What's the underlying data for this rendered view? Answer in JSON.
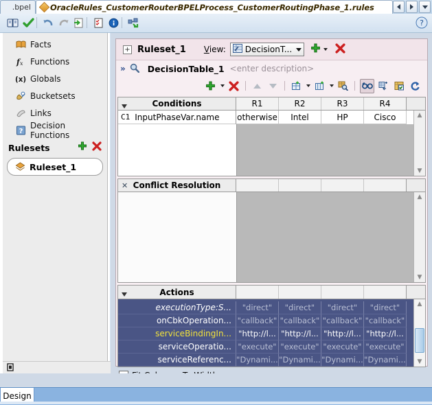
{
  "tabs": {
    "inactive_label": ".bpel",
    "active_label": "OracleRules_CustomerRouterBPELProcess_CustomerRoutingPhase_1.rules",
    "nav_prev": "◀",
    "nav_next": "▶",
    "nav_list": "▼"
  },
  "main_toolbar": {
    "items": [
      {
        "name": "dictionary-icon",
        "glyph": "📖"
      },
      {
        "name": "validate-check-icon",
        "glyph": "✔"
      },
      {
        "name": "undo-icon",
        "glyph": "↺"
      },
      {
        "name": "redo-icon",
        "glyph": "↻"
      },
      {
        "name": "export-icon",
        "glyph": "⇥"
      },
      {
        "name": "test-checklist-icon",
        "glyph": "☑"
      },
      {
        "name": "info-icon",
        "glyph": "i"
      },
      {
        "name": "link-dictionary-icon",
        "glyph": "⊞"
      }
    ],
    "help_label": "?"
  },
  "sidebar": {
    "items": [
      {
        "label": "Facts",
        "icon": "facts-icon",
        "glyph": "📙"
      },
      {
        "label": "Functions",
        "icon": "functions-icon",
        "glyph": "fx"
      },
      {
        "label": "Globals",
        "icon": "globals-icon",
        "glyph": "(x)"
      },
      {
        "label": "Bucketsets",
        "icon": "bucketsets-icon",
        "glyph": "🎨"
      },
      {
        "label": "Links",
        "icon": "links-icon",
        "glyph": "🔗"
      },
      {
        "label": "Decision Functions",
        "icon": "decision-functions-icon",
        "glyph": "?"
      }
    ],
    "section_title": "Rulesets",
    "add_label": "+",
    "delete_label": "✖",
    "ruleset_item": "Ruleset_1",
    "status_icon": "edit-marker-icon"
  },
  "ruleset": {
    "expander": "+",
    "name": "Ruleset_1",
    "view_label": "View:",
    "view_value": "DecisionT...",
    "view_icon": "decision-table-icon",
    "add_label": "+",
    "delete_label": "✖"
  },
  "decision_table": {
    "chevron": "»",
    "search_icon": "magnifier-icon",
    "name": "DecisionTable_1",
    "description_placeholder": "<enter description>",
    "toolbar": [
      {
        "name": "add-button",
        "glyph": "+",
        "has_dropdown": true
      },
      {
        "name": "delete-button",
        "glyph": "✖",
        "has_dropdown": false
      },
      {
        "name": "move-up-button",
        "glyph": "▲",
        "has_dropdown": false
      },
      {
        "name": "move-down-button",
        "glyph": "▼",
        "has_dropdown": false
      },
      {
        "name": "split-table-button",
        "glyph": "▦",
        "has_dropdown": true
      },
      {
        "name": "merge-table-button",
        "glyph": "▤",
        "has_dropdown": true
      },
      {
        "name": "find-rules-button",
        "glyph": "🔍",
        "has_dropdown": false
      },
      {
        "name": "gap-analysis-button",
        "glyph": "👓",
        "has_dropdown": false,
        "pressed": true
      },
      {
        "name": "compact-rules-button",
        "glyph": "⧉",
        "has_dropdown": false
      },
      {
        "name": "split-cells-button",
        "glyph": "▩",
        "has_dropdown": false
      },
      {
        "name": "refresh-button",
        "glyph": "↻",
        "has_dropdown": false
      }
    ]
  },
  "conditions": {
    "title": "Conditions",
    "rule_columns": [
      "R1",
      "R2",
      "R3",
      "R4"
    ],
    "rows": [
      {
        "id": "C1",
        "expression": "InputPhaseVar.name",
        "values": [
          "otherwise",
          "Intel",
          "HP",
          "Cisco"
        ]
      }
    ]
  },
  "conflict_resolution": {
    "title": "Conflict Resolution",
    "close_glyph": "✕",
    "rows": []
  },
  "actions": {
    "title": "Actions",
    "rows": [
      {
        "label": "executionType:S...",
        "highlighted": false,
        "italic": true,
        "values": [
          "\"direct\"",
          "\"direct\"",
          "\"direct\"",
          "\"direct\""
        ]
      },
      {
        "label": "onCbkOperation...",
        "highlighted": false,
        "italic": false,
        "values": [
          "\"callback\"",
          "\"callback\"",
          "\"callback\"",
          "\"callback\""
        ]
      },
      {
        "label": "serviceBindingIn...",
        "highlighted": true,
        "italic": false,
        "values": [
          "\"http://l...",
          "\"http://l...",
          "\"http://l...",
          "\"http://l..."
        ]
      },
      {
        "label": "serviceOperatio...",
        "highlighted": false,
        "italic": false,
        "values": [
          "\"execute\"",
          "\"execute\"",
          "\"execute\"",
          "\"execute\""
        ]
      },
      {
        "label": "serviceReferenc...",
        "highlighted": false,
        "italic": false,
        "values": [
          "\"Dynami...",
          "\"Dynami...",
          "\"Dynami...",
          "\"Dynami..."
        ]
      }
    ],
    "fit_columns_label": "Fit Columns To Width",
    "fit_columns_checked": "✔"
  },
  "bottom": {
    "design_tab": "Design"
  },
  "colors": {
    "actions_selection_bg": "#4a5585",
    "actions_highlight_text": "#f2e23c",
    "panel_chrome": "#f7eef2",
    "empty_grid": "#b9b9b9",
    "design_bar": "#8ab3e0"
  }
}
